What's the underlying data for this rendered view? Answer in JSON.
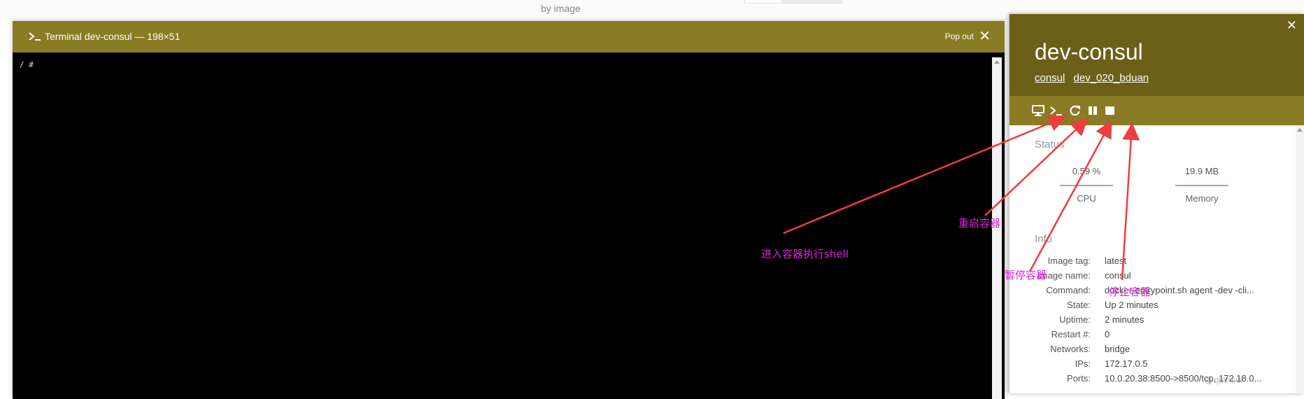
{
  "background": {
    "by_image": "by image"
  },
  "terminal": {
    "title": "Terminal dev-consul — 198×51",
    "pop_out_label": "Pop out",
    "close_label": "✕",
    "prompt_line": "/ #",
    "header_color": "#8a7b25"
  },
  "panel": {
    "title": "dev-consul",
    "links": [
      "consul",
      "dev_020_bduan"
    ],
    "close_label": "✕",
    "toolbar_icons": [
      "monitor-icon",
      "terminal-icon",
      "restart-icon",
      "pause-icon",
      "stop-icon"
    ],
    "status": {
      "title": "Status",
      "cpu": {
        "value": "0.59 %",
        "label": "CPU"
      },
      "memory": {
        "value": "19.9 MB",
        "label": "Memory"
      }
    },
    "info": {
      "title": "Info",
      "rows": [
        {
          "key": "Image tag:",
          "value": "latest"
        },
        {
          "key": "Image name:",
          "value": "consul"
        },
        {
          "key": "Command:",
          "value": "docker-entrypoint.sh agent -dev -cli..."
        },
        {
          "key": "State:",
          "value": "Up 2 minutes"
        },
        {
          "key": "Uptime:",
          "value": "2 minutes"
        },
        {
          "key": "Restart #:",
          "value": "0"
        },
        {
          "key": "Networks:",
          "value": "bridge"
        },
        {
          "key": "IPs:",
          "value": "172.17.0.5"
        },
        {
          "key": "Ports:",
          "value": "10.0.20.38:8500->8500/tcp, 172.18.0..."
        }
      ]
    }
  },
  "annotations": {
    "exec_shell": "进入容器执行shell",
    "restart": "重启容器",
    "pause": "暂停容器",
    "stop": "停止容器",
    "color": "#e020e0",
    "arrow_color": "#f03c3c"
  },
  "watermark": "@qiansui"
}
